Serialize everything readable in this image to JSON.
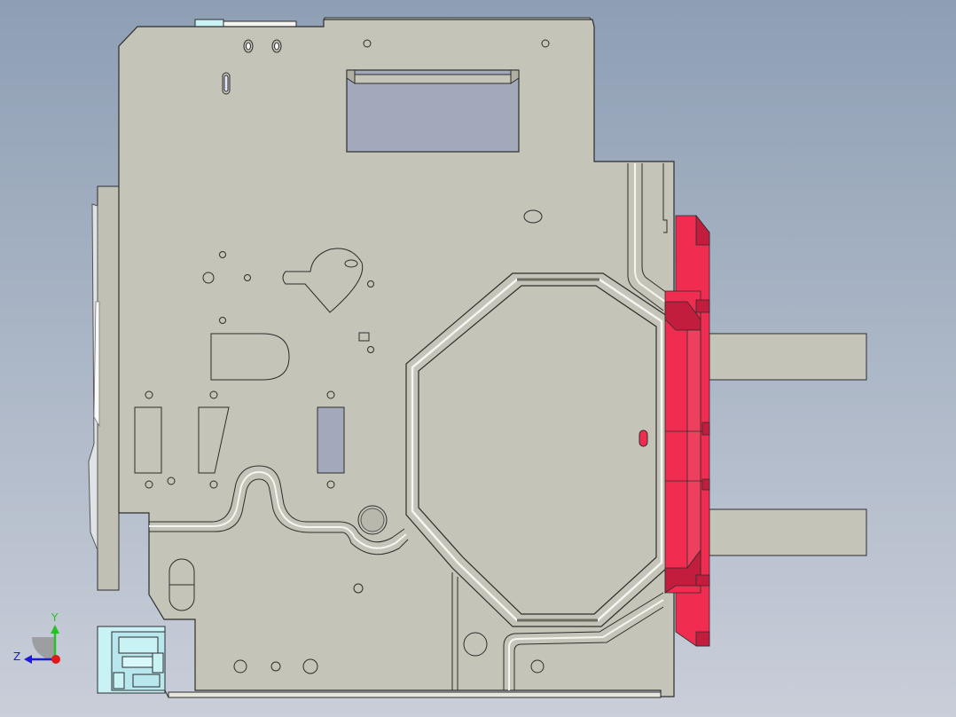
{
  "viewport": {
    "background_top": "#8e9fb4",
    "background_bottom": "#c9ced9"
  },
  "part": {
    "plate_color": "#c5c4b8",
    "edge_color": "#2d2d2d",
    "cutout_color": "#a2a9bb",
    "accent_color": "#f12c51",
    "accent_dark": "#c21d3d",
    "connector_color": "#c9f2f4"
  },
  "triad": {
    "y_label": "Y",
    "z_label": "Z",
    "y_color": "#21c421",
    "z_color": "#1b1bd1",
    "x_color": "#e01818"
  }
}
